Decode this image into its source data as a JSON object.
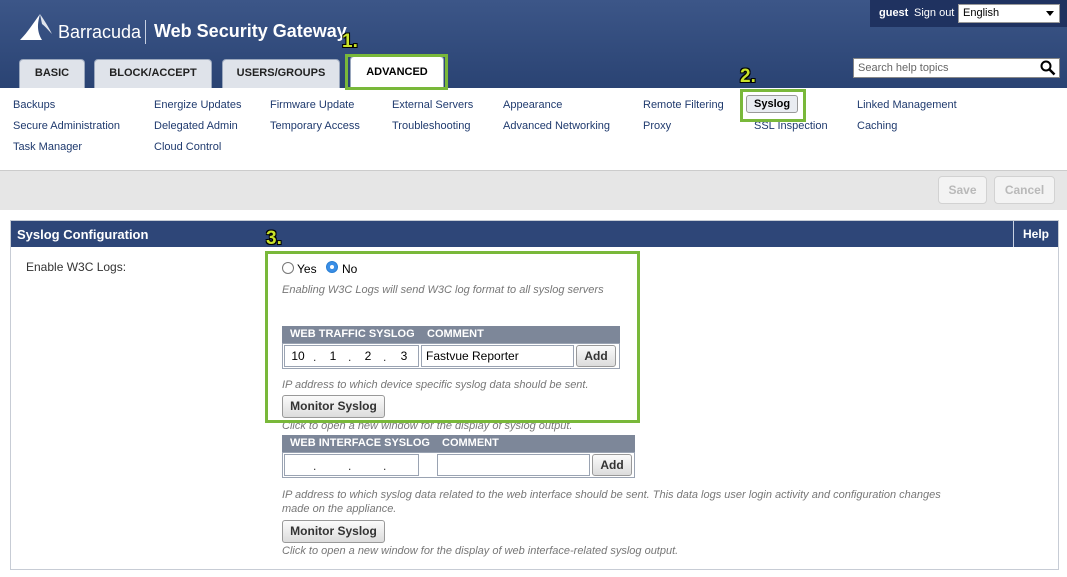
{
  "header": {
    "brand": "Barracuda",
    "product": "Web Security Gateway",
    "user": "guest",
    "signout": "Sign out",
    "language": "English",
    "search_placeholder": "Search help topics"
  },
  "tabs": [
    {
      "label": "BASIC"
    },
    {
      "label": "BLOCK/ACCEPT"
    },
    {
      "label": "USERS/GROUPS"
    },
    {
      "label": "ADVANCED"
    }
  ],
  "nav": {
    "items": [
      "Backups",
      "Secure Administration",
      "Task Manager",
      "Energize Updates",
      "Delegated Admin",
      "Cloud Control",
      "Firmware Update",
      "Temporary Access",
      "External Servers",
      "Troubleshooting",
      "Appearance",
      "Advanced Networking",
      "Remote Filtering",
      "Proxy",
      "Syslog",
      "SSL Inspection",
      "Linked Management",
      "Caching"
    ]
  },
  "actions": {
    "save": "Save",
    "cancel": "Cancel"
  },
  "panel": {
    "title": "Syslog Configuration",
    "help": "Help",
    "enable_label": "Enable W3C Logs:",
    "radio_yes": "Yes",
    "radio_no": "No",
    "selected": "No",
    "w3c_hint": "Enabling W3C Logs will send W3C log format to all syslog servers",
    "traffic": {
      "col1": "WEB TRAFFIC SYSLOG",
      "col2": "COMMENT",
      "ip": [
        "10",
        "1",
        "2",
        "3"
      ],
      "comment": "Fastvue Reporter",
      "add": "Add",
      "hint": "IP address to which device specific syslog data should be sent.",
      "monitor": "Monitor Syslog",
      "monitor_hint": "Click to open a new window for the display of syslog output."
    },
    "interface": {
      "col1": "WEB INTERFACE SYSLOG",
      "col2": "COMMENT",
      "add": "Add",
      "hint1": "IP address to which syslog data related to the web interface should be sent. This data logs user login activity and configuration changes",
      "hint2": "made on the appliance.",
      "monitor": "Monitor Syslog",
      "monitor_hint": "Click to open a new window for the display of web interface-related syslog output."
    }
  },
  "annotations": [
    "1.",
    "2.",
    "3."
  ],
  "colors": {
    "header": "#2e4678",
    "annotation": "#79b83a"
  }
}
